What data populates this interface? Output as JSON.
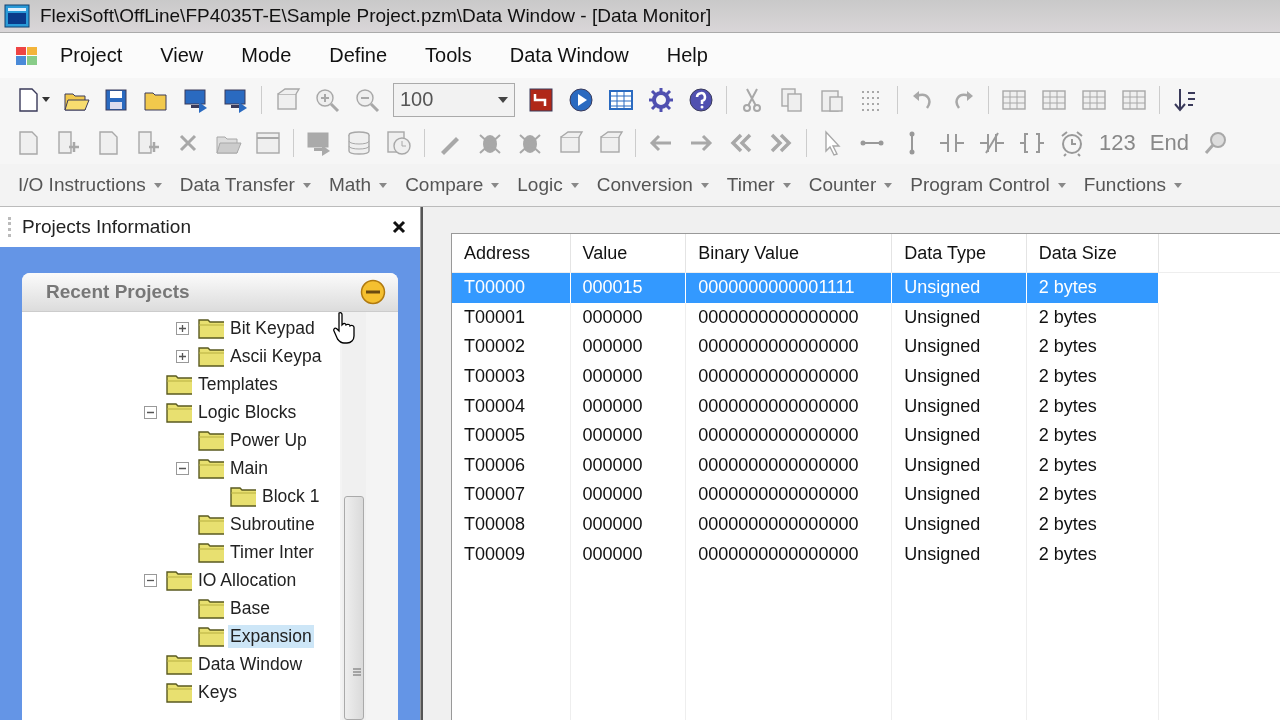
{
  "window": {
    "title": "FlexiSoft\\OffLine\\FP4035T-E\\Sample Project.pzm\\Data Window - [Data Monitor]"
  },
  "menu": [
    "Project",
    "View",
    "Mode",
    "Define",
    "Tools",
    "Data Window",
    "Help"
  ],
  "toolbar_1": [
    {
      "kind": "page",
      "disabled": false,
      "dropdown": true
    },
    {
      "kind": "open-folder",
      "disabled": false
    },
    {
      "kind": "disk",
      "disabled": false
    },
    {
      "kind": "folder",
      "disabled": false
    },
    {
      "kind": "monitor",
      "disabled": false
    },
    {
      "kind": "monitor",
      "disabled": false
    },
    {
      "kind": "separator"
    },
    {
      "kind": "box",
      "disabled": true
    },
    {
      "kind": "zoom-in",
      "disabled": true
    },
    {
      "kind": "zoom-out",
      "disabled": true
    },
    {
      "kind": "combo",
      "value": "100"
    },
    {
      "kind": "transfer",
      "disabled": false
    },
    {
      "kind": "play",
      "disabled": false
    },
    {
      "kind": "table",
      "disabled": false
    },
    {
      "kind": "gear",
      "disabled": false
    },
    {
      "kind": "help",
      "disabled": false
    },
    {
      "kind": "separator"
    },
    {
      "kind": "scissors",
      "disabled": true
    },
    {
      "kind": "copy",
      "disabled": true
    },
    {
      "kind": "paste",
      "disabled": true
    },
    {
      "kind": "dots",
      "disabled": true
    },
    {
      "kind": "separator"
    },
    {
      "kind": "undo",
      "disabled": true
    },
    {
      "kind": "redo",
      "disabled": true
    },
    {
      "kind": "separator"
    },
    {
      "kind": "grid",
      "disabled": true
    },
    {
      "kind": "grid",
      "disabled": true
    },
    {
      "kind": "grid",
      "disabled": true
    },
    {
      "kind": "grid",
      "disabled": true
    },
    {
      "kind": "separator"
    },
    {
      "kind": "sort",
      "disabled": false
    }
  ],
  "toolbar_2": [
    {
      "kind": "page",
      "disabled": true
    },
    {
      "kind": "page-plus",
      "disabled": true
    },
    {
      "kind": "page",
      "disabled": true
    },
    {
      "kind": "page-plus",
      "disabled": true
    },
    {
      "kind": "cross",
      "disabled": true
    },
    {
      "kind": "open-folder",
      "disabled": true
    },
    {
      "kind": "window",
      "disabled": true
    },
    {
      "kind": "separator"
    },
    {
      "kind": "monitor",
      "disabled": true
    },
    {
      "kind": "database",
      "disabled": true
    },
    {
      "kind": "clock",
      "disabled": true
    },
    {
      "kind": "separator"
    },
    {
      "kind": "pen",
      "disabled": true
    },
    {
      "kind": "bug",
      "disabled": true
    },
    {
      "kind": "bug",
      "disabled": true
    },
    {
      "kind": "box",
      "disabled": true
    },
    {
      "kind": "box",
      "disabled": true
    },
    {
      "kind": "separator"
    },
    {
      "kind": "arrow-left",
      "disabled": true
    },
    {
      "kind": "arrow-right",
      "disabled": true
    },
    {
      "kind": "double-left",
      "disabled": true
    },
    {
      "kind": "double-right",
      "disabled": true
    },
    {
      "kind": "separator"
    },
    {
      "kind": "pointer",
      "disabled": true
    },
    {
      "kind": "h-line",
      "disabled": true
    },
    {
      "kind": "v-line",
      "disabled": true
    },
    {
      "kind": "contact",
      "disabled": true
    },
    {
      "kind": "contact-nc",
      "disabled": true
    },
    {
      "kind": "coil",
      "disabled": true
    },
    {
      "kind": "alarm",
      "disabled": true
    },
    {
      "kind": "text",
      "label": "123",
      "disabled": true
    },
    {
      "kind": "text",
      "label": "End",
      "disabled": true
    },
    {
      "kind": "magnifier",
      "disabled": true
    }
  ],
  "instruction_bar": [
    "I/O Instructions",
    "Data Transfer",
    "Math",
    "Compare",
    "Logic",
    "Conversion",
    "Timer",
    "Counter",
    "Program Control",
    "Functions"
  ],
  "projects_panel": {
    "title": "Projects Information",
    "recent_projects": {
      "title": "Recent Projects",
      "partial_children": [
        {
          "label": "Bit Keypad",
          "expanded": false,
          "selected": false
        },
        {
          "label": "Ascii Keypa",
          "expanded": false,
          "selected": false
        }
      ],
      "items": [
        {
          "label": "Templates",
          "selected": false
        },
        {
          "label": "Logic Blocks",
          "expanded": true,
          "selected": false,
          "children": [
            {
              "label": "Power Up",
              "selected": false
            },
            {
              "label": "Main",
              "expanded": true,
              "selected": false,
              "children": [
                {
                  "label": "Block 1",
                  "selected": false
                }
              ]
            },
            {
              "label": "Subroutine",
              "selected": false
            },
            {
              "label": "Timer Inter",
              "selected": false
            }
          ]
        },
        {
          "label": "IO Allocation",
          "expanded": true,
          "selected": false,
          "children": [
            {
              "label": "Base",
              "selected": false
            },
            {
              "label": "Expansion",
              "selected": true
            }
          ]
        },
        {
          "label": "Data Window",
          "selected": false
        },
        {
          "label": "Keys",
          "selected": false
        }
      ]
    }
  },
  "table": {
    "columns": [
      "Address",
      "Value",
      "Binary Value",
      "Data Type",
      "Data Size"
    ],
    "rows": [
      {
        "cells": [
          "T00000",
          "000015",
          "0000000000001111",
          "Unsigned",
          "2 bytes"
        ],
        "selected": true
      },
      {
        "cells": [
          "T00001",
          "000000",
          "0000000000000000",
          "Unsigned",
          "2 bytes"
        ],
        "selected": false
      },
      {
        "cells": [
          "T00002",
          "000000",
          "0000000000000000",
          "Unsigned",
          "2 bytes"
        ],
        "selected": false
      },
      {
        "cells": [
          "T00003",
          "000000",
          "0000000000000000",
          "Unsigned",
          "2 bytes"
        ],
        "selected": false
      },
      {
        "cells": [
          "T00004",
          "000000",
          "0000000000000000",
          "Unsigned",
          "2 bytes"
        ],
        "selected": false
      },
      {
        "cells": [
          "T00005",
          "000000",
          "0000000000000000",
          "Unsigned",
          "2 bytes"
        ],
        "selected": false
      },
      {
        "cells": [
          "T00006",
          "000000",
          "0000000000000000",
          "Unsigned",
          "2 bytes"
        ],
        "selected": false
      },
      {
        "cells": [
          "T00007",
          "000000",
          "0000000000000000",
          "Unsigned",
          "2 bytes"
        ],
        "selected": false
      },
      {
        "cells": [
          "T00008",
          "000000",
          "0000000000000000",
          "Unsigned",
          "2 bytes"
        ],
        "selected": false
      },
      {
        "cells": [
          "T00009",
          "000000",
          "0000000000000000",
          "Unsigned",
          "2 bytes"
        ],
        "selected": false
      }
    ]
  }
}
